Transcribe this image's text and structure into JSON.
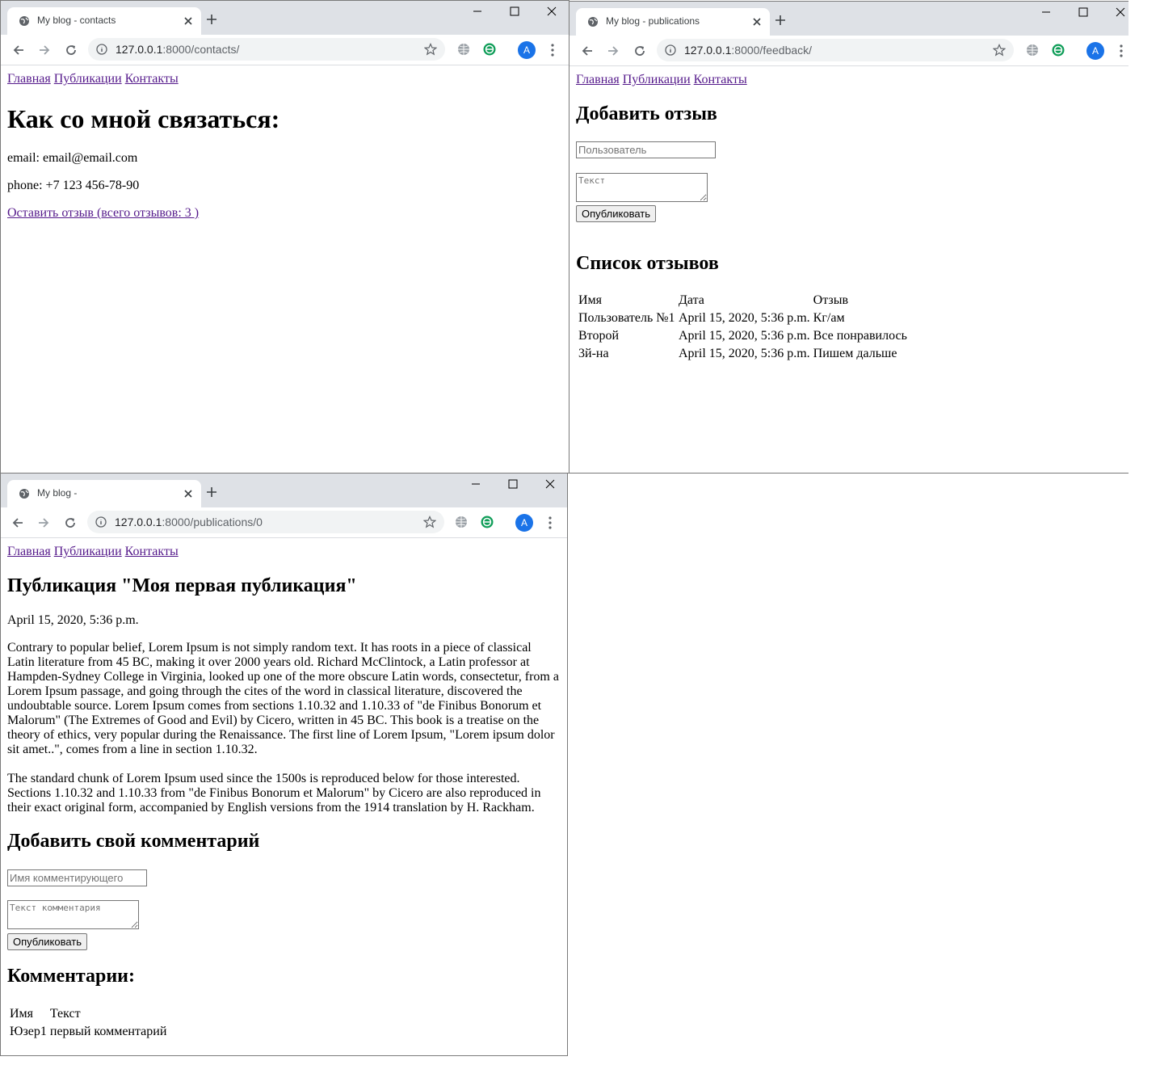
{
  "nav": {
    "home": "Главная",
    "publications": "Публикации",
    "contacts": "Контакты"
  },
  "windows": {
    "contacts": {
      "tab_title": "My blog - contacts",
      "url_host": "127.0.0.1",
      "url_rest": ":8000/contacts/",
      "avatar": "A",
      "heading": "Как со мной связаться:",
      "email": "email: email@email.com",
      "phone": "phone: +7 123 456-78-90",
      "feedback_link": "Оставить отзыв (всего отзывов: 3 )"
    },
    "feedback": {
      "tab_title": "My blog - publications",
      "url_host": "127.0.0.1",
      "url_rest": ":8000/feedback/",
      "avatar": "A",
      "add_heading": "Добавить отзыв",
      "user_placeholder": "Пользователь",
      "text_placeholder": "Текст",
      "submit": "Опубликовать",
      "list_heading": "Список отзывов",
      "columns": [
        "Имя",
        "Дата",
        "Отзыв"
      ],
      "rows": [
        [
          "Пользователь №1",
          "April 15, 2020, 5:36 p.m.",
          "Кг/ам"
        ],
        [
          "Второй",
          "April 15, 2020, 5:36 p.m.",
          "Все понравилось"
        ],
        [
          "3й-на",
          "April 15, 2020, 5:36 p.m.",
          "Пишем дальше"
        ]
      ]
    },
    "publication": {
      "tab_title": "My blog -",
      "url_host": "127.0.0.1",
      "url_rest": ":8000/publications/0",
      "avatar": "A",
      "heading": "Публикация \"Моя первая публикация\"",
      "date": "April 15, 2020, 5:36 p.m.",
      "para1": "Contrary to popular belief, Lorem Ipsum is not simply random text. It has roots in a piece of classical Latin literature from 45 BC, making it over 2000 years old. Richard McClintock, a Latin professor at Hampden-Sydney College in Virginia, looked up one of the more obscure Latin words, consectetur, from a Lorem Ipsum passage, and going through the cites of the word in classical literature, discovered the undoubtable source. Lorem Ipsum comes from sections 1.10.32 and 1.10.33 of \"de Finibus Bonorum et Malorum\" (The Extremes of Good and Evil) by Cicero, written in 45 BC. This book is a treatise on the theory of ethics, very popular during the Renaissance. The first line of Lorem Ipsum, \"Lorem ipsum dolor sit amet..\", comes from a line in section 1.10.32.",
      "para2": "The standard chunk of Lorem Ipsum used since the 1500s is reproduced below for those interested. Sections 1.10.32 and 1.10.33 from \"de Finibus Bonorum et Malorum\" by Cicero are also reproduced in their exact original form, accompanied by English versions from the 1914 translation by H. Rackham.",
      "comment_heading": "Добавить свой комментарий",
      "name_placeholder": "Имя комментирующего",
      "text_placeholder": "Текст комментария",
      "submit": "Опубликовать",
      "comments_heading": "Комментарии:",
      "columns": [
        "Имя",
        "Текст"
      ],
      "rows": [
        [
          "Юзер1",
          "первый комментарий"
        ]
      ]
    }
  },
  "colors": {
    "titlebar": "#dee1e6",
    "link_visited": "#551a8b",
    "avatar": "#1a73e8"
  }
}
